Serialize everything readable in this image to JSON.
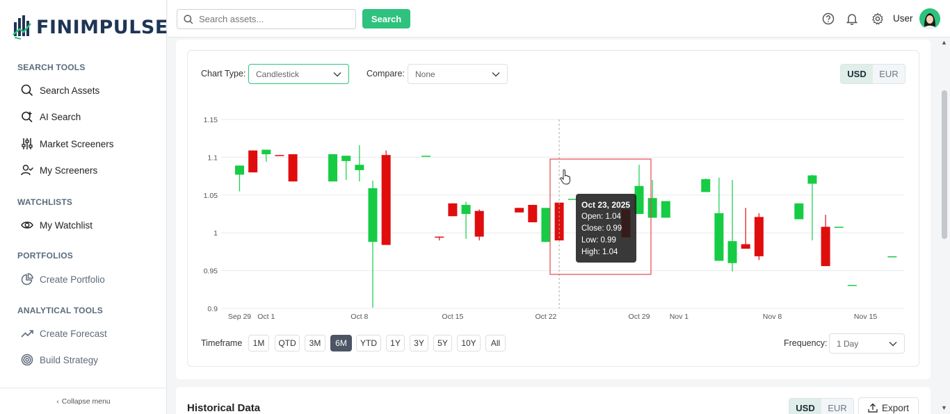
{
  "app": {
    "name": "FINIMPULSE"
  },
  "sidebar": {
    "sections": [
      {
        "title": "SEARCH TOOLS",
        "items": [
          {
            "label": "Search Assets",
            "icon": "search-icon"
          },
          {
            "label": "AI Search",
            "icon": "ai-search-icon"
          },
          {
            "label": "Market Screeners",
            "icon": "sliders-icon"
          },
          {
            "label": "My Screeners",
            "icon": "user-check-icon"
          }
        ]
      },
      {
        "title": "WATCHLISTS",
        "items": [
          {
            "label": "My Watchlist",
            "icon": "eye-icon"
          }
        ]
      },
      {
        "title": "PORTFOLIOS",
        "items": [
          {
            "label": "Create Portfolio",
            "icon": "pie-chart-icon"
          }
        ]
      },
      {
        "title": "ANALYTICAL TOOLS",
        "items": [
          {
            "label": "Create Forecast",
            "icon": "trending-up-icon"
          },
          {
            "label": "Build Strategy",
            "icon": "target-icon"
          }
        ]
      }
    ],
    "collapse_label": "Collapse menu"
  },
  "topbar": {
    "search_placeholder": "Search assets...",
    "search_button": "Search",
    "user_label": "User"
  },
  "chart_controls": {
    "chart_type_label": "Chart Type:",
    "chart_type_value": "Candlestick",
    "compare_label": "Compare:",
    "compare_value": "None",
    "currency_options": [
      "USD",
      "EUR"
    ],
    "currency_selected": "USD",
    "timeframe_label": "Timeframe",
    "timeframes": [
      "1M",
      "QTD",
      "3M",
      "6M",
      "YTD",
      "1Y",
      "3Y",
      "5Y",
      "10Y",
      "All"
    ],
    "timeframe_selected": "6M",
    "frequency_label": "Frequency:",
    "frequency_value": "1 Day"
  },
  "tooltip": {
    "date": "Oct 23, 2025",
    "open": "Open: 1.04",
    "close": "Close: 0.99",
    "low": "Low: 0.99",
    "high": "High: 1.04"
  },
  "chart_data": {
    "type": "candlestick",
    "ylim": [
      0.9,
      1.15
    ],
    "y_ticks": [
      "1.15",
      "1.1",
      "1.05",
      "1",
      "0.95",
      "0.9"
    ],
    "x_ticks": [
      {
        "label": "Sep 29",
        "day": 0
      },
      {
        "label": "Oct 1",
        "day": 2
      },
      {
        "label": "Oct 8",
        "day": 9
      },
      {
        "label": "Oct 15",
        "day": 16
      },
      {
        "label": "Oct 22",
        "day": 23
      },
      {
        "label": "Oct 29",
        "day": 30
      },
      {
        "label": "Nov 1",
        "day": 33
      },
      {
        "label": "Nov 8",
        "day": 40
      },
      {
        "label": "Nov 15",
        "day": 47
      }
    ],
    "candles": [
      {
        "date": "Sep 29",
        "open": 1.077,
        "close": 1.089,
        "high": 1.089,
        "low": 1.055
      },
      {
        "date": "Sep 30",
        "open": 1.109,
        "close": 1.08,
        "high": 1.109,
        "low": 1.08
      },
      {
        "date": "Oct 1",
        "open": 1.104,
        "close": 1.11,
        "high": 1.11,
        "low": 1.094
      },
      {
        "date": "Oct 2",
        "open": 1.103,
        "close": 1.102,
        "high": 1.103,
        "low": 1.102
      },
      {
        "date": "Oct 3",
        "open": 1.104,
        "close": 1.068,
        "high": 1.104,
        "low": 1.068
      },
      {
        "date": "Oct 6",
        "open": 1.068,
        "close": 1.104,
        "high": 1.104,
        "low": 1.068
      },
      {
        "date": "Oct 7",
        "open": 1.095,
        "close": 1.102,
        "high": 1.102,
        "low": 1.07
      },
      {
        "date": "Oct 8",
        "open": 1.083,
        "close": 1.09,
        "high": 1.116,
        "low": 1.068
      },
      {
        "date": "Oct 9",
        "open": 0.988,
        "close": 1.059,
        "high": 1.069,
        "low": 0.901
      },
      {
        "date": "Oct 10",
        "open": 1.103,
        "close": 0.984,
        "high": 1.109,
        "low": 0.984
      },
      {
        "date": "Oct 13",
        "open": 1.102,
        "close": 1.102,
        "high": 1.102,
        "low": 1.102
      },
      {
        "date": "Oct 14",
        "open": 0.995,
        "close": 0.994,
        "high": 0.995,
        "low": 0.99
      },
      {
        "date": "Oct 15",
        "open": 1.039,
        "close": 1.022,
        "high": 1.039,
        "low": 1.022
      },
      {
        "date": "Oct 16",
        "open": 1.025,
        "close": 1.037,
        "high": 1.041,
        "low": 0.992
      },
      {
        "date": "Oct 17",
        "open": 1.029,
        "close": 0.995,
        "high": 1.031,
        "low": 0.99
      },
      {
        "date": "Oct 20",
        "open": 1.033,
        "close": 1.027,
        "high": 1.033,
        "low": 1.027
      },
      {
        "date": "Oct 21",
        "open": 1.037,
        "close": 1.014,
        "high": 1.037,
        "low": 1.014
      },
      {
        "date": "Oct 22",
        "open": 0.988,
        "close": 1.033,
        "high": 1.033,
        "low": 0.988
      },
      {
        "date": "Oct 23",
        "open": 1.04,
        "close": 0.99,
        "high": 1.04,
        "low": 0.99
      },
      {
        "date": "Oct 24",
        "open": 1.045,
        "close": 1.045,
        "high": 1.045,
        "low": 1.045
      },
      {
        "date": "Oct 28",
        "open": 1.031,
        "close": 0.994,
        "high": 1.031,
        "low": 0.994
      },
      {
        "date": "Oct 29",
        "open": 1.025,
        "close": 1.062,
        "high": 1.09,
        "low": 1.025
      },
      {
        "date": "Oct 30",
        "open": 1.02,
        "close": 1.046,
        "high": 1.07,
        "low": 1.02
      },
      {
        "date": "Oct 31",
        "open": 1.02,
        "close": 1.042,
        "high": 1.042,
        "low": 1.02
      },
      {
        "date": "Nov 3",
        "open": 1.054,
        "close": 1.071,
        "high": 1.072,
        "low": 1.054
      },
      {
        "date": "Nov 4",
        "open": 0.963,
        "close": 1.026,
        "high": 1.073,
        "low": 0.963
      },
      {
        "date": "Nov 5",
        "open": 0.96,
        "close": 0.989,
        "high": 1.07,
        "low": 0.949
      },
      {
        "date": "Nov 6",
        "open": 0.985,
        "close": 0.979,
        "high": 1.033,
        "low": 0.979
      },
      {
        "date": "Nov 7",
        "open": 1.021,
        "close": 0.969,
        "high": 1.026,
        "low": 0.964
      },
      {
        "date": "Nov 10",
        "open": 1.018,
        "close": 1.039,
        "high": 1.039,
        "low": 1.018
      },
      {
        "date": "Nov 11",
        "open": 1.065,
        "close": 1.076,
        "high": 1.077,
        "low": 0.99
      },
      {
        "date": "Nov 12",
        "open": 1.008,
        "close": 0.956,
        "high": 1.024,
        "low": 0.956
      },
      {
        "date": "Nov 13",
        "open": 1.008,
        "close": 1.008,
        "high": 1.008,
        "low": 1.008
      },
      {
        "date": "Nov 14",
        "open": 0.931,
        "close": 0.931,
        "high": 0.931,
        "low": 0.931
      },
      {
        "date": "Nov 17",
        "open": 0.969,
        "close": 0.969,
        "high": 0.969,
        "low": 0.969
      }
    ],
    "highlighted_date": "Oct 23",
    "colors": {
      "up": "#15cc44",
      "down": "#e00d0d",
      "highlight_box": "#e4474d",
      "grid": "#e8eaed"
    }
  },
  "historical": {
    "title": "Historical Data",
    "currency_options": [
      "USD",
      "EUR"
    ],
    "currency_selected": "USD",
    "export_label": "Export"
  },
  "colors": {
    "accent": "#2ec27e",
    "brand": "#1f3556"
  }
}
